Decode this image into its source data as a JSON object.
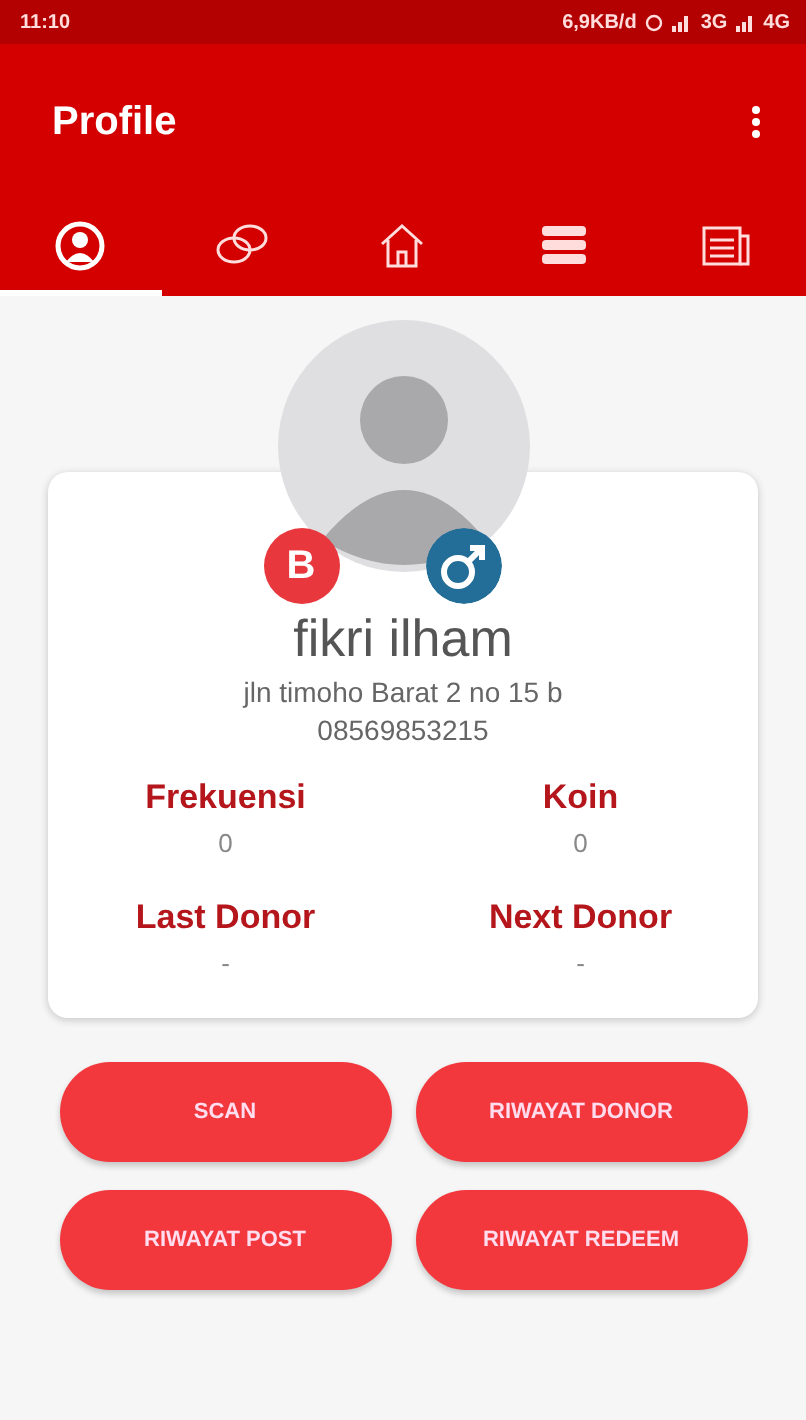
{
  "status_bar": {
    "time": "11:10",
    "speed": "6,9KB/d",
    "network_1": "3G",
    "network_2": "4G"
  },
  "app_bar": {
    "title": "Profile"
  },
  "tabs": [
    {
      "kind": "profile",
      "selected": true
    },
    {
      "kind": "chat",
      "selected": false
    },
    {
      "kind": "home",
      "selected": false
    },
    {
      "kind": "list",
      "selected": false
    },
    {
      "kind": "news",
      "selected": false
    }
  ],
  "profile": {
    "blood_type": "B",
    "gender_badge": {
      "kind": "male"
    },
    "name": "fikri ilham",
    "address": "jln timoho Barat 2 no 15 b",
    "phone": "08569853215"
  },
  "stats": [
    {
      "label": "Frekuensi",
      "value": "0"
    },
    {
      "label": "Koin",
      "value": "0"
    },
    {
      "label": "Last Donor",
      "value": "-"
    },
    {
      "label": "Next Donor",
      "value": "-"
    }
  ],
  "buttons": [
    "SCAN",
    "RIWAYAT DONOR",
    "RIWAYAT POST",
    "RIWAYAT REDEEM"
  ]
}
